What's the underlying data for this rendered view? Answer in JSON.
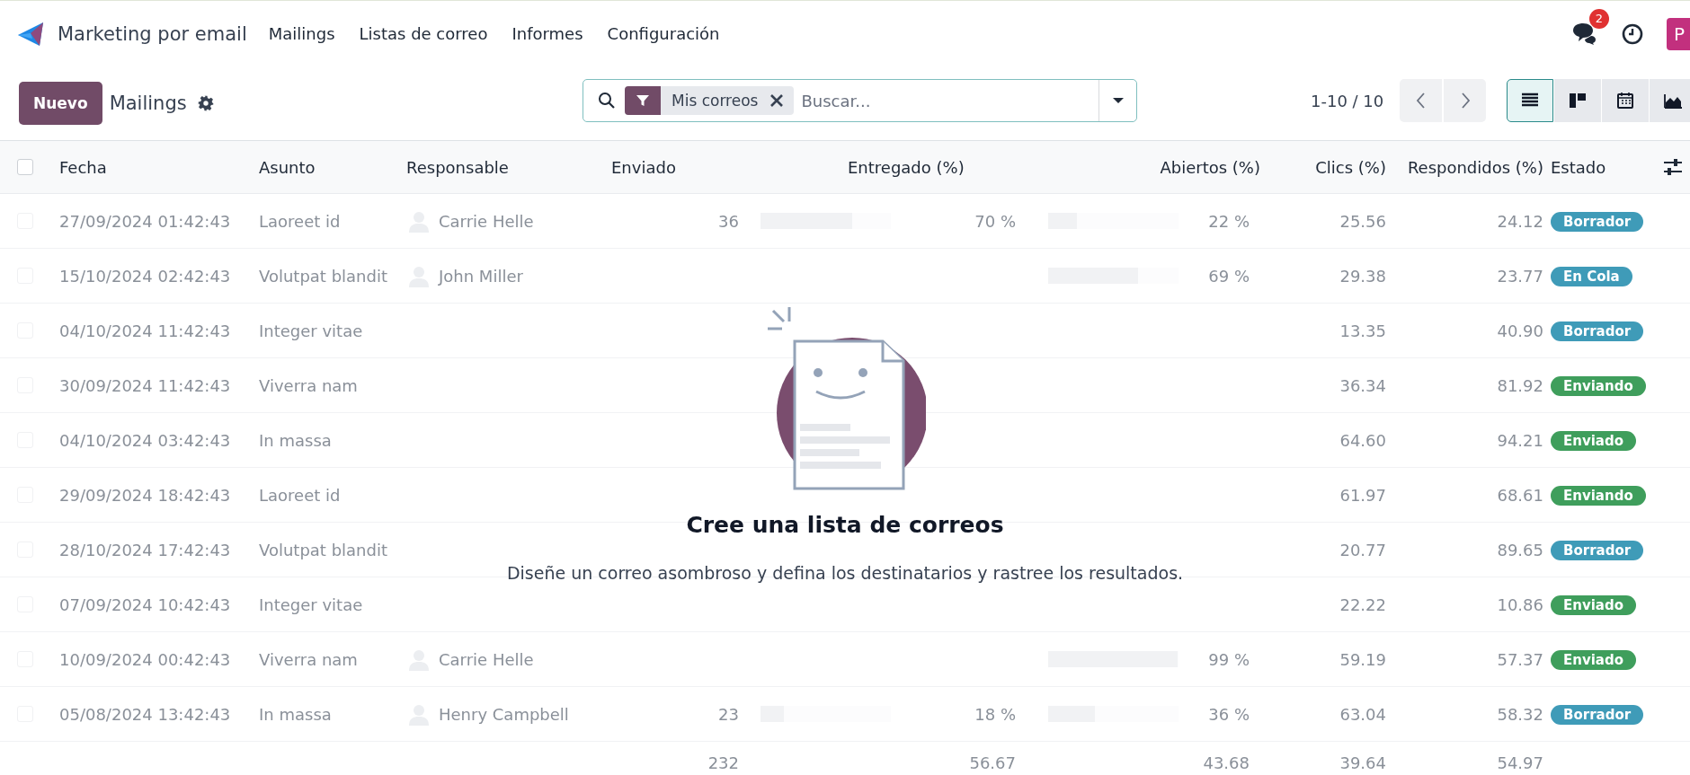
{
  "app": {
    "title": "Marketing por email",
    "menu": [
      {
        "label": "Mailings"
      },
      {
        "label": "Listas de correo"
      },
      {
        "label": "Informes"
      },
      {
        "label": "Configuración"
      }
    ]
  },
  "systray": {
    "messages_badge": "2",
    "avatar": "P"
  },
  "control_panel": {
    "new_button": "Nuevo",
    "breadcrumb": "Mailings",
    "search": {
      "facets": [
        {
          "label": "Mis correos"
        }
      ],
      "placeholder": "Buscar..."
    },
    "pager": "1-10 / 10",
    "views": [
      {
        "kind": "list",
        "selected": true
      },
      {
        "kind": "kanban",
        "selected": false
      },
      {
        "kind": "calendar",
        "selected": false
      },
      {
        "kind": "graph",
        "selected": false
      }
    ]
  },
  "table": {
    "select_all_checked": false,
    "columns": [
      "Fecha",
      "Asunto",
      "Responsable",
      "Enviado",
      "Entregado (%)",
      "Abiertos (%)",
      "Clics (%)",
      "Respondidos (%)",
      "Estado"
    ],
    "rows": [
      {
        "checked": false,
        "date": "27/09/2024 01:42:43",
        "subject": "Laoreet id",
        "responsible": "Carrie Helle",
        "sent": "36",
        "delivered": {
          "level": 0.7,
          "text": "70 %"
        },
        "opened": {
          "level": 0.22,
          "text": "22 %"
        },
        "clicks": "25.56",
        "replied": "24.12",
        "status": {
          "label": "Borrador",
          "kind": "draft"
        }
      },
      {
        "checked": false,
        "date": "15/10/2024 02:42:43",
        "subject": "Volutpat blandit",
        "responsible": "John Miller",
        "opened": {
          "level": 0.69,
          "text": "69 %"
        },
        "clicks": "29.38",
        "replied": "23.77",
        "status": {
          "label": "En Cola",
          "kind": "queue"
        }
      },
      {
        "checked": false,
        "date": "04/10/2024 11:42:43",
        "subject": "Integer vitae",
        "clicks": "13.35",
        "replied": "40.90",
        "status": {
          "label": "Borrador",
          "kind": "draft"
        }
      },
      {
        "checked": false,
        "date": "30/09/2024 11:42:43",
        "subject": "Viverra nam",
        "clicks": "36.34",
        "replied": "81.92",
        "status": {
          "label": "Enviando",
          "kind": "sending"
        }
      },
      {
        "checked": false,
        "date": "04/10/2024 03:42:43",
        "subject": "In massa",
        "clicks": "64.60",
        "replied": "94.21",
        "status": {
          "label": "Enviado",
          "kind": "sent"
        }
      },
      {
        "checked": false,
        "date": "29/09/2024 18:42:43",
        "subject": "Laoreet id",
        "clicks": "61.97",
        "replied": "68.61",
        "status": {
          "label": "Enviando",
          "kind": "sending"
        }
      },
      {
        "checked": false,
        "date": "28/10/2024 17:42:43",
        "subject": "Volutpat blandit",
        "clicks": "20.77",
        "replied": "89.65",
        "status": {
          "label": "Borrador",
          "kind": "draft"
        }
      },
      {
        "checked": false,
        "date": "07/09/2024 10:42:43",
        "subject": "Integer vitae",
        "clicks": "22.22",
        "replied": "10.86",
        "status": {
          "label": "Enviado",
          "kind": "sent"
        }
      },
      {
        "checked": false,
        "date": "10/09/2024 00:42:43",
        "subject": "Viverra nam",
        "responsible": "Carrie Helle",
        "opened": {
          "level": 0.99,
          "text": "99 %"
        },
        "clicks": "59.19",
        "replied": "57.37",
        "status": {
          "label": "Enviado",
          "kind": "sent"
        }
      },
      {
        "checked": false,
        "date": "05/08/2024 13:42:43",
        "subject": "In massa",
        "responsible": "Henry Campbell",
        "sent": "23",
        "delivered": {
          "level": 0.18,
          "text": "18 %"
        },
        "opened": {
          "level": 0.36,
          "text": "36 %"
        },
        "clicks": "63.04",
        "replied": "58.32",
        "status": {
          "label": "Borrador",
          "kind": "draft"
        }
      }
    ],
    "totals": {
      "sent": "232",
      "delivered": "56.67",
      "opened": "43.68",
      "clicks": "39.64",
      "replied": "54.97"
    }
  },
  "empty_state": {
    "title": "Cree una lista de correos",
    "text": "Diseñe un correo asombroso y defina los destinatarios y rastree los resultados."
  }
}
